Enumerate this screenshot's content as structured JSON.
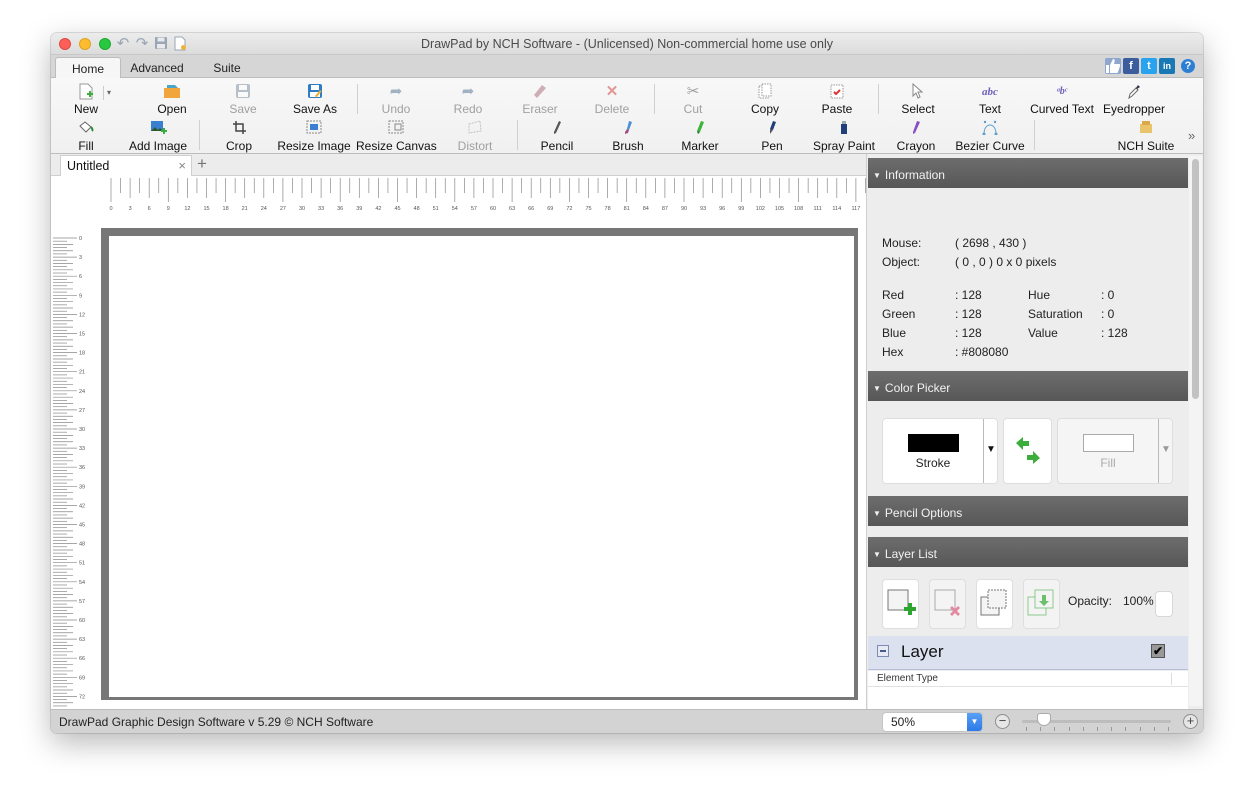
{
  "window": {
    "title": "DrawPad by NCH Software - (Unlicensed) Non-commercial home use only",
    "quick_access": [
      "undo-icon",
      "redo-icon",
      "save-icon",
      "new-document-icon"
    ]
  },
  "tabs": {
    "items": [
      {
        "label": "Home",
        "active": true
      },
      {
        "label": "Advanced",
        "active": false
      },
      {
        "label": "Suite",
        "active": false
      }
    ],
    "social": [
      "like-icon",
      "facebook-icon",
      "twitter-icon",
      "linkedin-icon",
      "help-icon"
    ],
    "social_glyphs": {
      "like": "👍",
      "facebook": "f",
      "twitter": "t",
      "linkedin": "in",
      "help": "?"
    }
  },
  "toolbar": {
    "row1": [
      {
        "label": "New",
        "icon": "new-file-icon",
        "disabled": false
      },
      {
        "label": "Open",
        "icon": "open-folder-icon",
        "disabled": false
      },
      {
        "label": "Save",
        "icon": "save-icon",
        "disabled": true
      },
      {
        "label": "Save As",
        "icon": "save-as-icon",
        "disabled": false
      },
      {
        "label": "Undo",
        "icon": "undo-icon",
        "disabled": true
      },
      {
        "label": "Redo",
        "icon": "redo-icon",
        "disabled": true
      },
      {
        "label": "Eraser",
        "icon": "eraser-icon",
        "disabled": true
      },
      {
        "label": "Delete",
        "icon": "delete-icon",
        "disabled": true
      },
      {
        "label": "Cut",
        "icon": "scissors-icon",
        "disabled": true
      },
      {
        "label": "Copy",
        "icon": "copy-icon",
        "disabled": false
      },
      {
        "label": "Paste",
        "icon": "paste-icon",
        "disabled": false
      },
      {
        "label": "Select",
        "icon": "cursor-icon",
        "disabled": false
      },
      {
        "label": "Text",
        "icon": "text-icon",
        "disabled": false
      },
      {
        "label": "Curved Text",
        "icon": "curved-text-icon",
        "disabled": false
      },
      {
        "label": "Eyedropper",
        "icon": "eyedropper-icon",
        "disabled": false
      }
    ],
    "row2": [
      {
        "label": "Fill",
        "icon": "fill-bucket-icon",
        "disabled": false
      },
      {
        "label": "Add Image",
        "icon": "add-image-icon",
        "disabled": false
      },
      {
        "label": "Crop",
        "icon": "crop-icon",
        "disabled": false
      },
      {
        "label": "Resize Image",
        "icon": "resize-image-icon",
        "disabled": false
      },
      {
        "label": "Resize Canvas",
        "icon": "resize-canvas-icon",
        "disabled": false
      },
      {
        "label": "Distort",
        "icon": "distort-icon",
        "disabled": true
      },
      {
        "label": "Pencil",
        "icon": "pencil-icon",
        "disabled": false
      },
      {
        "label": "Brush",
        "icon": "brush-icon",
        "disabled": false
      },
      {
        "label": "Marker",
        "icon": "marker-icon",
        "disabled": false
      },
      {
        "label": "Pen",
        "icon": "pen-icon",
        "disabled": false
      },
      {
        "label": "Spray Paint",
        "icon": "spray-paint-icon",
        "disabled": false
      },
      {
        "label": "Crayon",
        "icon": "crayon-icon",
        "disabled": false
      },
      {
        "label": "Bezier Curve",
        "icon": "bezier-curve-icon",
        "disabled": false
      },
      {
        "label": "NCH Suite",
        "icon": "nch-suite-icon",
        "disabled": false
      }
    ],
    "overflow": "»"
  },
  "document": {
    "tab_title": "Untitled",
    "close_glyph": "×",
    "add_glyph": "+"
  },
  "rulers": {
    "top_labels": [
      "0",
      "3",
      "6",
      "9",
      "12",
      "15",
      "18",
      "21",
      "24",
      "27",
      "30",
      "33",
      "36",
      "39",
      "42",
      "45",
      "48",
      "51",
      "54",
      "57",
      "60",
      "63",
      "66",
      "69",
      "72",
      "75",
      "78",
      "81",
      "84",
      "87",
      "90",
      "93",
      "96",
      "99",
      "102",
      "105",
      "108",
      "111",
      "114",
      "117"
    ],
    "left_labels": [
      "0",
      "3",
      "6",
      "9",
      "12",
      "15",
      "18",
      "21",
      "24",
      "27",
      "30",
      "33",
      "36",
      "39",
      "42",
      "45",
      "48",
      "51",
      "54",
      "57",
      "60",
      "63",
      "66",
      "69",
      "72"
    ]
  },
  "panel": {
    "information": {
      "title": "Information",
      "mouse_label": "Mouse:",
      "mouse_value": "( 2698 , 430 )",
      "object_label": "Object:",
      "object_value": "( 0 , 0 ) 0 x 0 pixels",
      "red_label": "Red",
      "red_value": ": 128",
      "green_label": "Green",
      "green_value": ": 128",
      "blue_label": "Blue",
      "blue_value": ": 128",
      "hex_label": "Hex",
      "hex_value": ": #808080",
      "hue_label": "Hue",
      "hue_value": ": 0",
      "saturation_label": "Saturation",
      "saturation_value": ": 0",
      "value_label": "Value",
      "value_value": ": 128"
    },
    "color_picker": {
      "title": "Color Picker",
      "stroke_label": "Stroke",
      "stroke_color": "#000000",
      "fill_label": "Fill",
      "fill_color": "#ffffff",
      "swap_icon": "swap-arrows-icon"
    },
    "pencil_options": {
      "title": "Pencil Options"
    },
    "layer_list": {
      "title": "Layer List",
      "buttons": [
        {
          "name": "add-layer",
          "disabled": false
        },
        {
          "name": "delete-layer",
          "disabled": true
        },
        {
          "name": "duplicate-layer",
          "disabled": false
        },
        {
          "name": "merge-layer-down",
          "disabled": true
        }
      ],
      "opacity_label": "Opacity:",
      "opacity_value": "100%",
      "layer_name": "Layer",
      "layer_visible": true,
      "column_header": "Element Type"
    }
  },
  "statusbar": {
    "text": "DrawPad Graphic Design Software v 5.29 © NCH Software",
    "zoom_value": "50%",
    "zoom_minus": "−",
    "zoom_plus": "+",
    "zoom_slider_fraction": 0.15
  },
  "colors": {
    "accent_blue": "#2c7ae8",
    "panel_header": "#5f5f5f",
    "canvas_border": "#777777",
    "layer_row": "#dbe1ef"
  }
}
